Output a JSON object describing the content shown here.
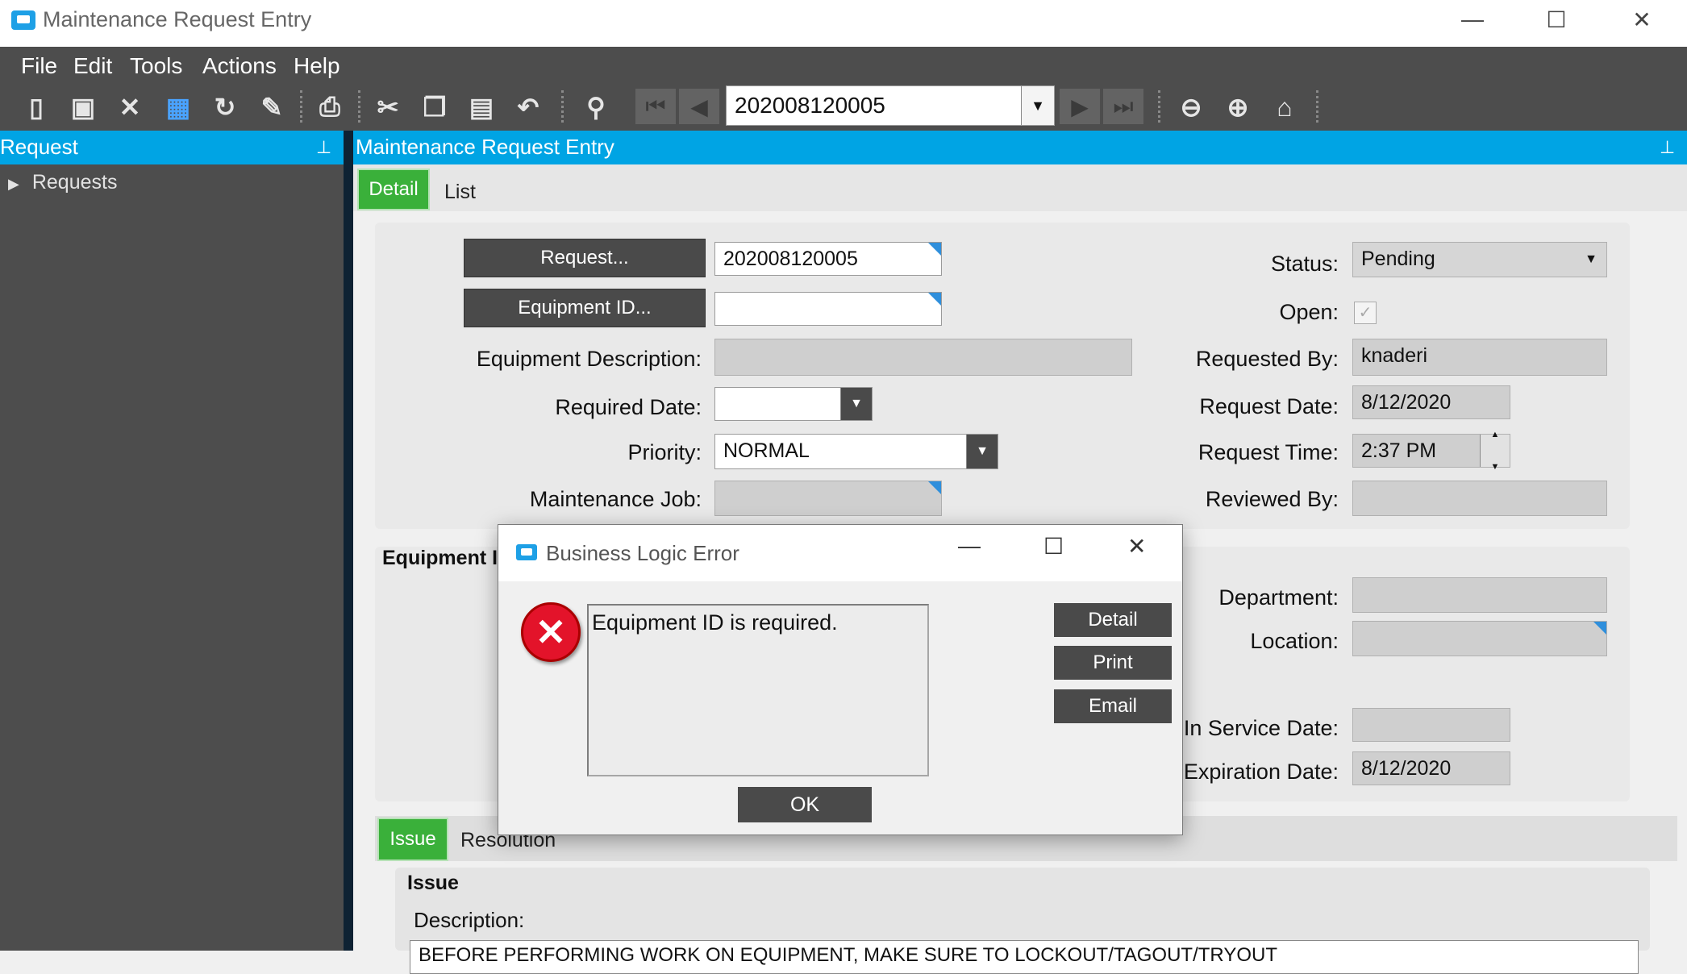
{
  "window": {
    "title": "Maintenance Request Entry",
    "min_glyph": "—",
    "max_glyph": "☐",
    "close_glyph": "✕"
  },
  "menu": [
    "File",
    "Edit",
    "Tools",
    "Actions",
    "Help"
  ],
  "toolbar": {
    "nav_value": "202008120005"
  },
  "left_panel": {
    "title": "Request",
    "tree_item": "Requests"
  },
  "main": {
    "title": "Maintenance Request Entry",
    "tabs": [
      "Detail",
      "List"
    ]
  },
  "form": {
    "request_button": "Request...",
    "request_value": "202008120005",
    "equipment_button": "Equipment ID...",
    "equipment_value": "",
    "equipment_desc_label": "Equipment Description:",
    "required_date_label": "Required Date:",
    "required_date_value": "",
    "priority_label": "Priority:",
    "priority_value": "NORMAL",
    "maintenance_job_label": "Maintenance Job:",
    "status_label": "Status:",
    "status_value": "Pending",
    "open_label": "Open:",
    "requested_by_label": "Requested By:",
    "requested_by_value": "knaderi",
    "request_date_label": "Request Date:",
    "request_date_value": "8/12/2020",
    "request_time_label": "Request Time:",
    "request_time_value": "2:37 PM",
    "reviewed_by_label": "Reviewed By:",
    "equipment_section_label": "Equipment I",
    "department_label": "Department:",
    "location_label": "Location:",
    "in_service_label": "In Service Date:",
    "expiration_label": "Expiration Date:",
    "expiration_value": "8/12/2020"
  },
  "lower": {
    "tabs": [
      "Issue",
      "Resolution"
    ],
    "section_title": "Issue",
    "description_label": "Description:",
    "description_text": "BEFORE PERFORMING WORK ON EQUIPMENT, MAKE SURE TO LOCKOUT/TAGOUT/TRYOUT"
  },
  "dialog": {
    "title": "Business Logic Error",
    "message": "Equipment ID is required.",
    "buttons": [
      "Detail",
      "Print",
      "Email"
    ],
    "ok": "OK"
  },
  "colors": {
    "accent": "#00a4e4",
    "tab_active": "#3ab03a",
    "dark_panel": "#4d4d4d",
    "error": "#e3132a"
  }
}
